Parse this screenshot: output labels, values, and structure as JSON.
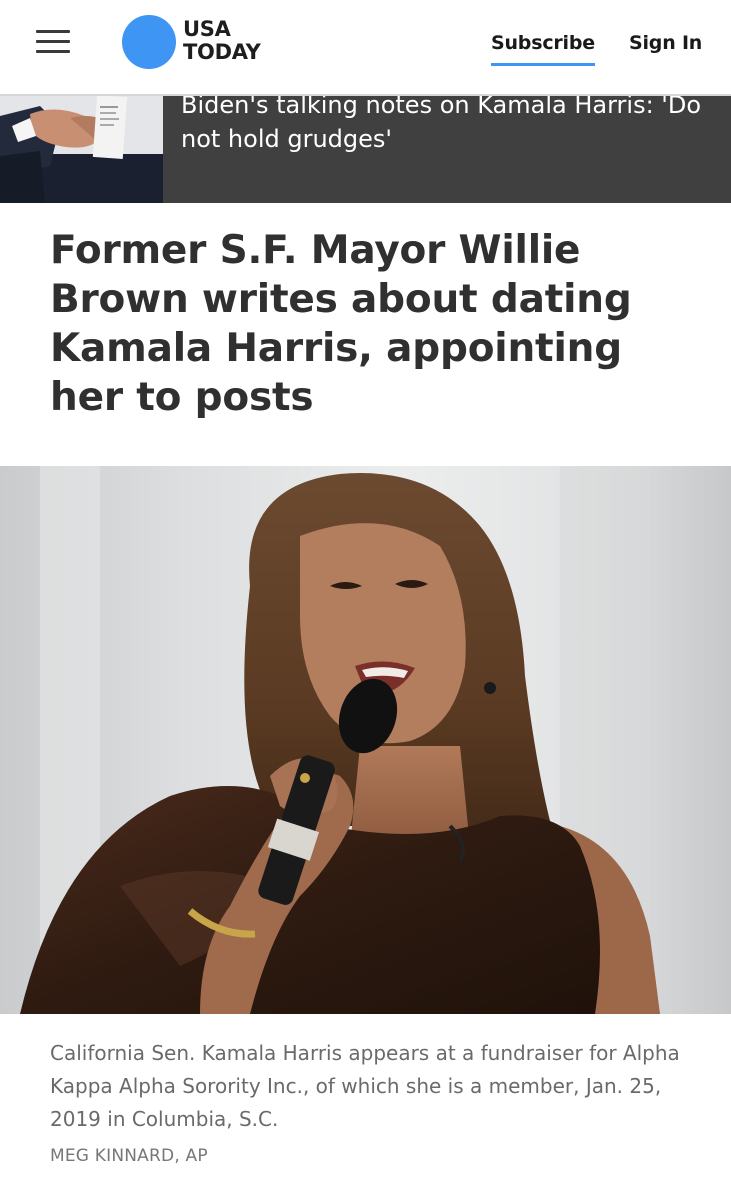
{
  "header": {
    "logo_line1": "USA",
    "logo_line2": "TODAY",
    "subscribe_label": "Subscribe",
    "signin_label": "Sign In",
    "menu_icon": "hamburger-menu-icon",
    "brand_color": "#3f95f3"
  },
  "related_story": {
    "title": "Biden's talking notes on Kamala Harris: 'Do not hold grudges'"
  },
  "article": {
    "headline": "Former S.F. Mayor Willie Brown writes about dating Kamala Harris, appointing her to posts",
    "photo_caption": "California Sen. Kamala Harris appears at a fundraiser for Alpha Kappa Alpha Sorority Inc., of which she is a member, Jan. 25, 2019 in Columbia, S.C.",
    "photo_credit": "MEG KINNARD, AP"
  }
}
